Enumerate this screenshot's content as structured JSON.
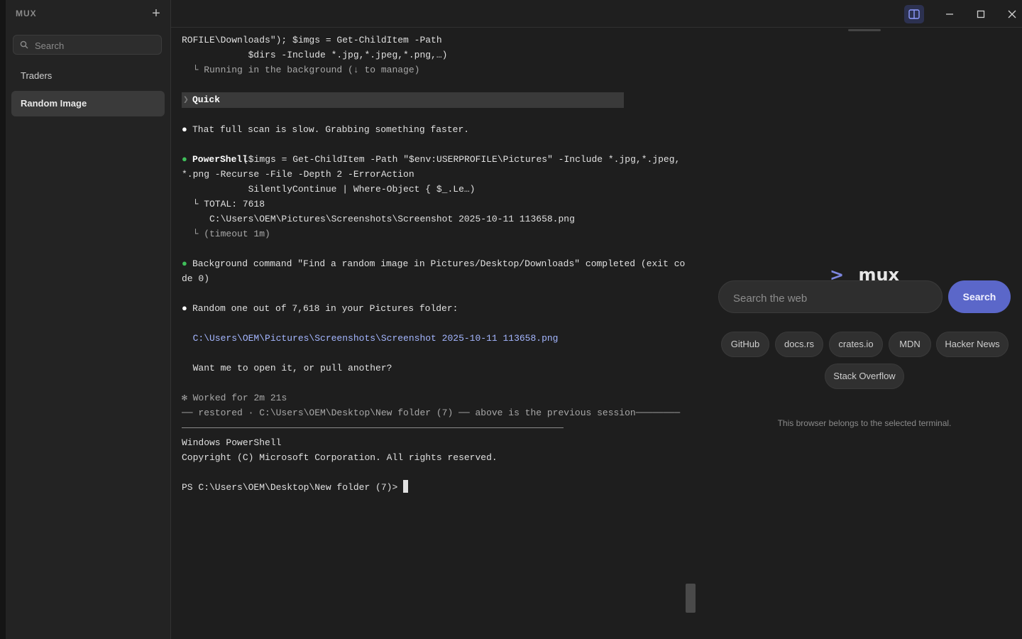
{
  "app": {
    "brand": "MUX",
    "add_label": "+"
  },
  "sidebar": {
    "search_placeholder": "Search",
    "items": [
      {
        "label": "Traders",
        "active": false
      },
      {
        "label": "Random Image",
        "active": true
      }
    ]
  },
  "titlebar": {
    "buttons": [
      "split-view-icon",
      "minimize-icon",
      "maximize-icon",
      "close-icon"
    ],
    "accent": "#5b67c9"
  },
  "terminal": {
    "lines": [
      "ROFILE\\Downloads\"); $imgs = Get-ChildItem -Path",
      "            $dirs -Include *.jpg,*.jpeg,*.png,…)",
      "  └ Running in the background (↓ to manage)",
      "Quick",
      "That full scan is slow. Grabbing something faster.",
      "PowerShell",
      "($imgs = Get-ChildItem -Path \"$env:USERPROFILE\\Pictures\" -Include *.jpg,*.jpeg,",
      "*.png -Recurse -File -Depth 2 -ErrorAction",
      "            SilentlyContinue | Where-Object { $_.Le…)",
      "  └ TOTAL: 7618",
      "     C:\\Users\\OEM\\Pictures\\Screenshots\\Screenshot 2025-10-11 113658.png",
      "  └ (timeout 1m)",
      "Background command \"Find a random image in Pictures/Desktop/Downloads\" completed (exit co",
      "de 0)",
      "Random one out of 7,618 in your Pictures folder:",
      "  C:\\Users\\OEM\\Pictures\\Screenshots\\Screenshot 2025-10-11 113658.png",
      "  Want me to open it, or pull another?",
      "✻ Worked for 2m 21s",
      "── restored · C:\\Users\\OEM\\Desktop\\New folder (7) ── above is the previous session────────",
      "Windows PowerShell",
      "Copyright (C) Microsoft Corporation. All rights reserved.",
      "PS C:\\Users\\OEM\\Desktop\\New folder (7)> "
    ],
    "bullet": "●",
    "chevron": "❯"
  },
  "browser": {
    "logo_prompt": ">_",
    "logo_word": "mux",
    "search_placeholder": "Search the web",
    "search_button": "Search",
    "chips": [
      "GitHub",
      "docs.rs",
      "crates.io",
      "MDN",
      "Hacker News",
      "Stack Overflow"
    ],
    "note": "This browser belongs to the selected terminal."
  }
}
